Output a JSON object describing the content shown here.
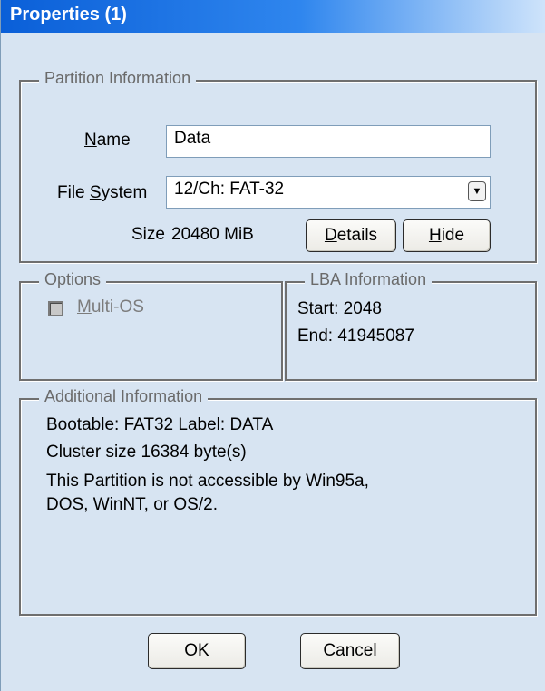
{
  "window": {
    "title": "Properties (1)"
  },
  "partition": {
    "group_label": "Partition Information",
    "name_label_pre": "",
    "name_label_u": "N",
    "name_label_post": "ame",
    "name_value": "Data",
    "fs_label_pre": "File ",
    "fs_label_u": "S",
    "fs_label_post": "ystem",
    "fs_value": "12/Ch: FAT-32",
    "size_label": "Size",
    "size_value": "20480 MiB",
    "details_u": "D",
    "details_rest": "etails",
    "hide_u": "H",
    "hide_rest": "ide"
  },
  "options": {
    "group_label": "Options",
    "multi_os_u": "M",
    "multi_os_rest": "ulti-OS",
    "multi_os_checked": false
  },
  "lba": {
    "group_label": "LBA Information",
    "start": "Start: 2048",
    "end": "End: 41945087"
  },
  "additional": {
    "group_label": "Additional Information",
    "lines": [
      "Bootable: FAT32   Label: DATA",
      "Cluster size 16384 byte(s)",
      "This Partition is not accessible by Win95a,",
      "DOS, WinNT, or OS/2."
    ]
  },
  "buttons": {
    "ok": "OK",
    "cancel": "Cancel"
  }
}
